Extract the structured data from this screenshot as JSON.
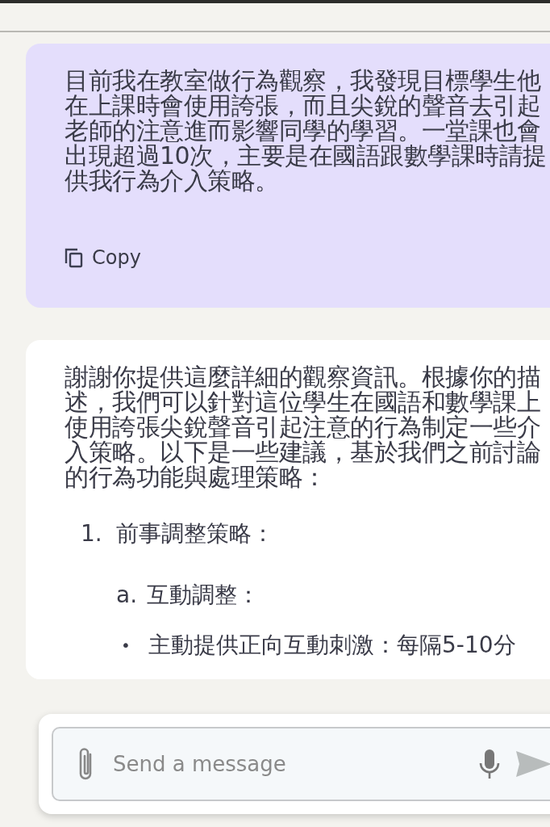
{
  "messages": [
    {
      "kind": "user",
      "text": "目前我在教室做行為觀察，我發現目標學生他在上課時會使用誇張，而且尖銳的聲音去引起老師的注意進而影響同學的學習。一堂課也會出現超過10次，主要是在國語跟數學課時請提供我行為介入策略。",
      "action": "Copy"
    },
    {
      "kind": "assistant",
      "text": "謝謝你提供這麼詳細的觀察資訊。根據你的描述，我們可以針對這位學生在國語和數學課上使用誇張尖銳聲音引起注意的行為制定一些介入策略。以下是一些建議，基於我們之前討論的行為功能與處理策略：",
      "list": [
        {
          "marker": "1.",
          "text": "前事調整策略：",
          "children": [
            {
              "marker": "a.",
              "text": "互動調整：",
              "children": [
                {
                  "marker": "•",
                  "text": "主動提供正向互動刺激：每隔5-10分"
                }
              ]
            }
          ]
        }
      ]
    }
  ],
  "composer": {
    "placeholder": "Send a message"
  }
}
